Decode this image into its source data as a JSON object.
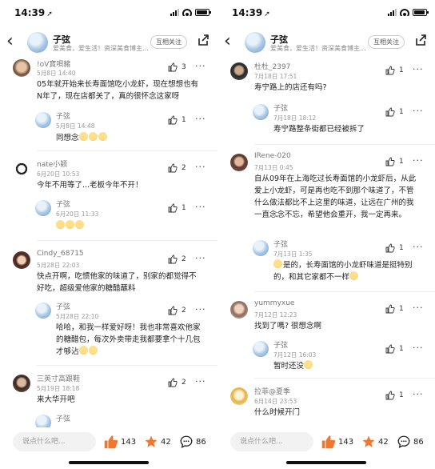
{
  "left": {
    "status": {
      "time": "14:39"
    },
    "nav": {
      "name": "子弦",
      "subtitle": "爱美食，爱生活！资深美食博主...",
      "follow": "互相关注"
    },
    "comments": [
      {
        "name": "!oV寶唄豬",
        "time": "5月8日 14:40",
        "likes": "3",
        "text": "05年就开始来长寿面馆吃小龙虾，现在想想也有N年了，现在店都关了，真的很怀念这家呀"
      },
      {
        "reply": true,
        "name": "子弦",
        "time": "5月8日 14:48",
        "likes": "1",
        "text": "同想念"
      },
      {
        "name": "nate小颖",
        "time": "6月20日 10:53",
        "likes": "2",
        "text": "今年不用等了...老板今年不开！"
      },
      {
        "reply": true,
        "name": "子弦",
        "time": "6月20日 11:33",
        "likes": "1",
        "text": ""
      },
      {
        "name": "Cindy_68715",
        "time": "5月28日 22:03",
        "likes": "2",
        "text": "快点开啊，吃惯他家的味道了，别家的都觉得不好吃，超级爱他家的糖醋蘸料"
      },
      {
        "reply": true,
        "name": "子弦",
        "time": "5月28日 22:10",
        "likes": "2",
        "text": "哈哈，和我一样爱好呀！我也非常喜欢他家的糖醋包，每次外卖带走我都要拿个十几包才够沾"
      },
      {
        "name": "三英寸高跟鞋",
        "time": "5月19日 18:18",
        "likes": "2",
        "text": "来大华开吧"
      },
      {
        "reply": true,
        "name": "子弦",
        "time": "",
        "likes": "",
        "text": ""
      }
    ],
    "bottom": {
      "input_placeholder": "说点什么吧...",
      "likes": "143",
      "stars": "42",
      "comments": "86"
    }
  },
  "right": {
    "status": {
      "time": "14:39"
    },
    "nav": {
      "name": "子弦",
      "subtitle": "爱美食，爱生活！资深美食博主...",
      "follow": "互相关注"
    },
    "comments": [
      {
        "name": "杜杜_2397",
        "time": "7月18日 17:51",
        "likes": "1",
        "text": "寿宁路上的店还有吗?"
      },
      {
        "reply": true,
        "name": "子弦",
        "time": "7月18日 18:12",
        "likes": "1",
        "text": "寿宁路整条街都已经被拆了"
      },
      {
        "name": "IRene-020",
        "time": "7月13日 0:45",
        "likes": "1",
        "text": "自从09年在上海吃过长寿面馆的小龙虾后，从此爱上小龙虾，可是再也吃不到那个味道了，不管什么做法都比不上这里的味道，让远在广州的我一直念念不忘，希望他会重开，我一定再来。"
      },
      {
        "reply": true,
        "name": "子弦",
        "time": "7月13日 1:35",
        "likes": "1",
        "text": "是的，长寿面馆的小龙虾味道是挺特别的，和其它家都不一样"
      },
      {
        "name": "yummyxue",
        "time": "7月12日 12:23",
        "likes": "1",
        "text": "找到了嗎? 很想念啊"
      },
      {
        "reply": true,
        "name": "子弦",
        "time": "7月12日 16:03",
        "likes": "1",
        "text": "暂时还没"
      },
      {
        "name": "拉菲@夏季",
        "time": "6月14日 23:53",
        "likes": "1",
        "text": "什么时候开门"
      }
    ],
    "bottom": {
      "input_placeholder": "说点什么吧...",
      "likes": "143",
      "stars": "42",
      "comments": "86"
    }
  },
  "colors": {
    "like_orange": "#f0772f",
    "star_orange": "#f0772f",
    "text": "#222222",
    "meta": "#999999"
  },
  "icons": [
    "back-arrow-icon",
    "share-icon",
    "thumb-up-icon",
    "more-dots-icon",
    "star-icon",
    "comment-bubble-icon",
    "smile-emoji-icon"
  ]
}
